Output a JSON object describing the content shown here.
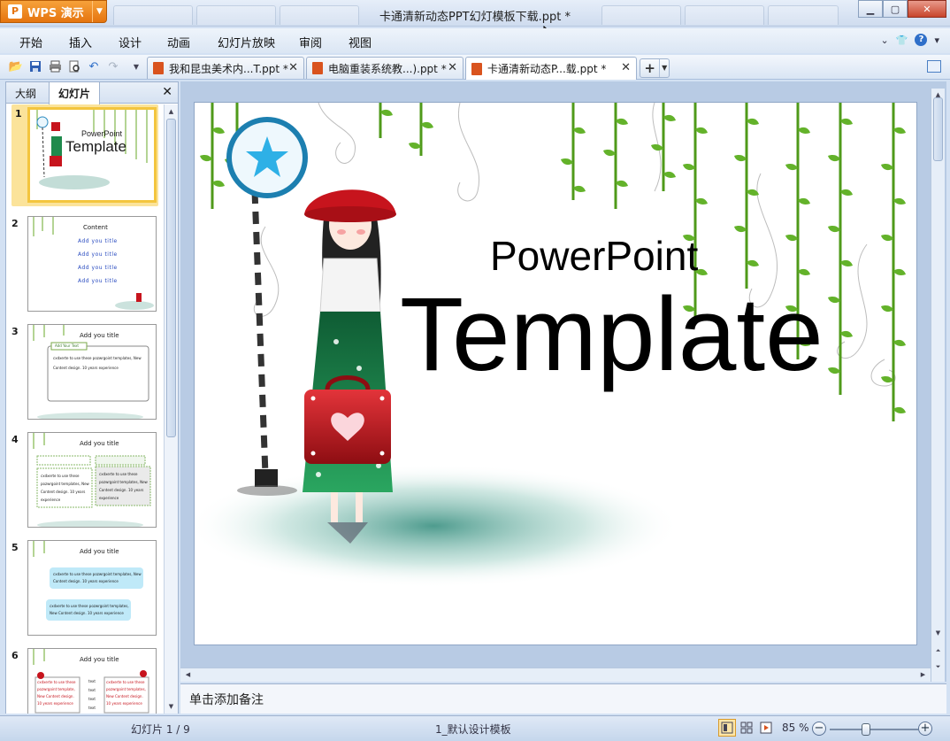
{
  "app": {
    "brand_label": "WPS 演示",
    "window_title": "卡通清新动态PPT幻灯模板下载.ppt *"
  },
  "menu": {
    "items": [
      "开始",
      "插入",
      "设计",
      "动画",
      "幻灯片放映",
      "审阅",
      "视图"
    ]
  },
  "tabs": [
    {
      "label": "我和昆虫美术内...T.ppt *"
    },
    {
      "label": "电脑重装系统教...).ppt *"
    },
    {
      "label": "卡通清新动态P...载.ppt *"
    }
  ],
  "left_panel": {
    "tab_outline": "大纲",
    "tab_slides": "幻灯片",
    "thumbnails": [
      {
        "num": "1",
        "title": "PowerPoint",
        "subtitle": "Template"
      },
      {
        "num": "2",
        "heading": "Content",
        "items": [
          "Add you title",
          "Add you title",
          "Add you title",
          "Add you title"
        ]
      },
      {
        "num": "3",
        "heading": "Add you title",
        "box_label": "Add Your Text",
        "body": "cxdxerte to use these pozwrgoint templates, New Content design. 10 years experience"
      },
      {
        "num": "4",
        "heading": "Add you title",
        "left_text": "cxdxerte to use these pozwrgoint templates, New Content design. 10 years experience",
        "right_text": "cxdxerte to use these pozwrgoint templates, New Content design. 10 years experience"
      },
      {
        "num": "5",
        "heading": "Add you title",
        "box1": "cxdxerte to use these pozwrgoint templates, New Content design. 10 years experience",
        "box2": "cxdxerte to use these pozwrgoint templates, New Content design. 10 years experience"
      },
      {
        "num": "6",
        "heading": "Add you title",
        "left_red": "cxdxerte to use these pozwrgoint template, New Content design. 10 years experience",
        "right_red": "cxdxerte to use these pozwrgoint templates, New Content design. 10 years experience",
        "mid": [
          "text",
          "text",
          "text",
          "text"
        ]
      }
    ]
  },
  "slide": {
    "title": "PowerPoint",
    "subtitle": "Template"
  },
  "notes": {
    "placeholder": "单击添加备注"
  },
  "status": {
    "slide_counter": "幻灯片 1 / 9",
    "template_name": "1_默认设计模板",
    "zoom": "85 %"
  },
  "colors": {
    "accent_orange": "#e5740f",
    "vine_green": "#5aa81c",
    "hat_red": "#c7141d",
    "skirt_green": "#1f8a4c",
    "star_blue": "#2eb0e6"
  }
}
